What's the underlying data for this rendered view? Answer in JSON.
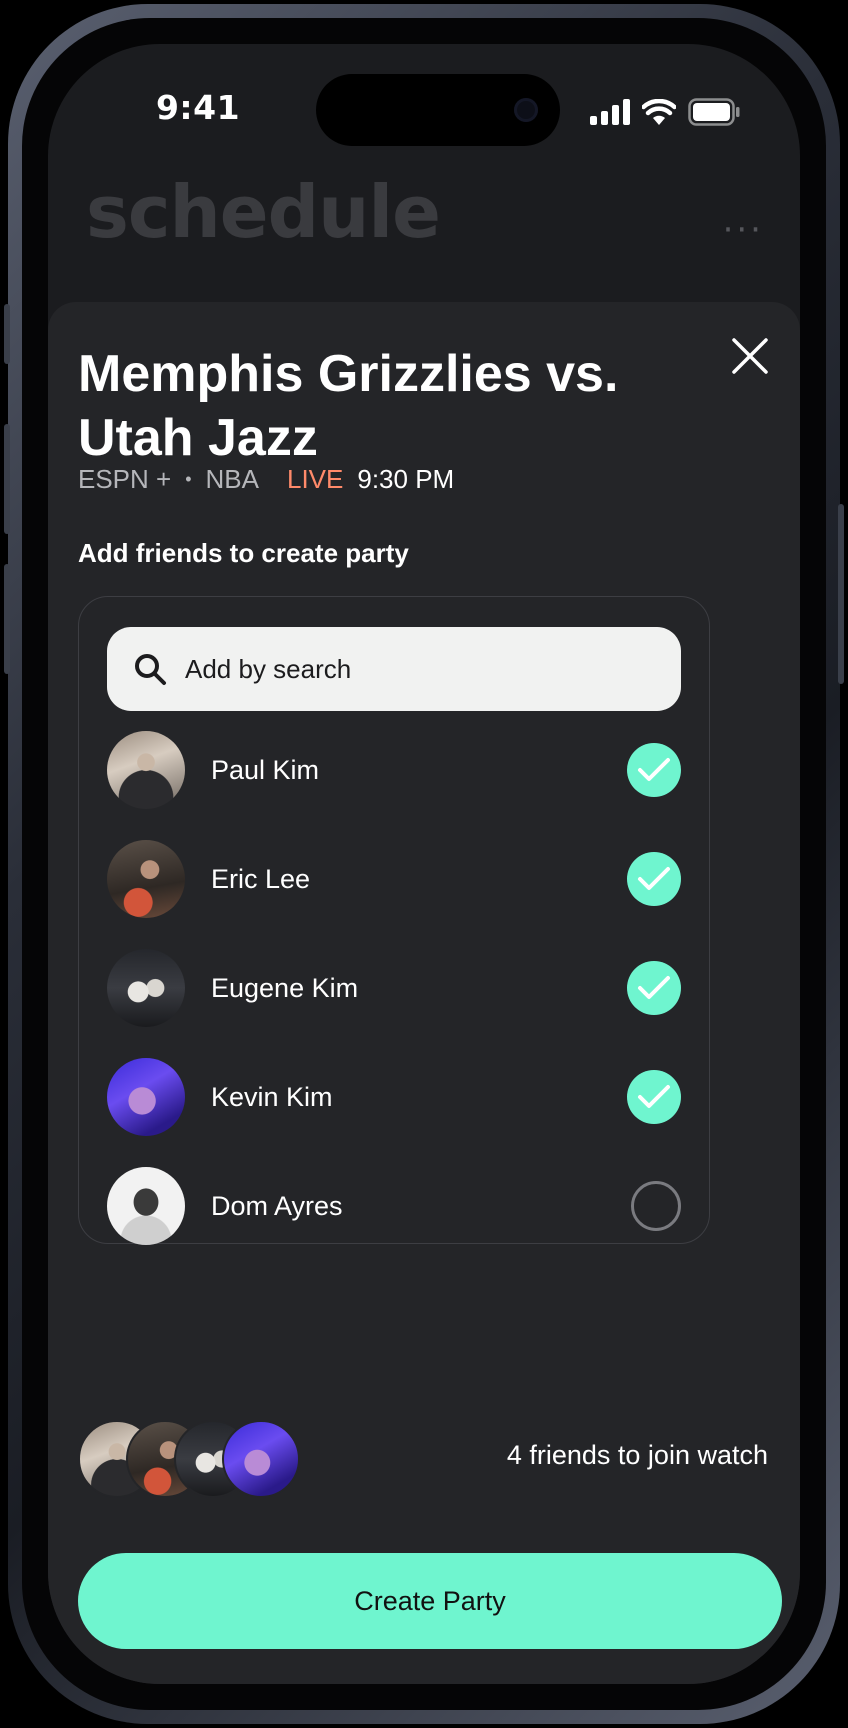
{
  "status_bar": {
    "time": "9:41"
  },
  "background": {
    "title": "schedule",
    "menu": "···"
  },
  "sheet": {
    "title": "Memphis Grizzlies vs. Utah Jazz",
    "meta": {
      "network": "ESPN +",
      "separator": "•",
      "league": "NBA",
      "live": "LIVE",
      "time": "9:30 PM"
    },
    "subhead": "Add friends to create party",
    "search": {
      "placeholder": "Add by search"
    },
    "friends": [
      {
        "name": "Paul Kim",
        "selected": true
      },
      {
        "name": "Eric Lee",
        "selected": true
      },
      {
        "name": "Eugene Kim",
        "selected": true
      },
      {
        "name": "Kevin Kim",
        "selected": true
      },
      {
        "name": "Dom Ayres",
        "selected": false
      }
    ],
    "join_summary": "4 friends to join watch",
    "cta": "Create Party"
  },
  "colors": {
    "accent": "#6ff5cf",
    "live": "#ff8a6a",
    "sheet_bg": "#242528"
  }
}
